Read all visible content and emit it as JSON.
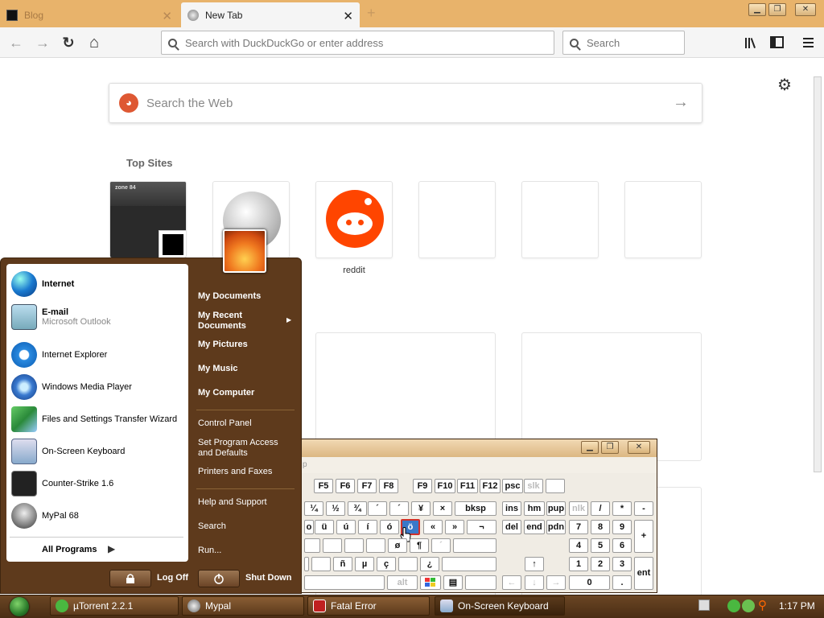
{
  "browser": {
    "tabs": [
      {
        "label": "Blog",
        "active": false
      },
      {
        "label": "New Tab",
        "active": true
      }
    ],
    "new_tab_symbol": "+",
    "window_controls": {
      "minimize": "▁",
      "restore": "❐",
      "close": "✕"
    },
    "nav": {
      "back": "←",
      "forward": "→",
      "reload": "↻",
      "home": "⌂"
    },
    "address_placeholder": "Search with DuckDuckGo or enter address",
    "search_placeholder": "Search",
    "toolbar_icons": [
      "library-icon",
      "sidebar-icon",
      "menu-icon"
    ]
  },
  "newtab": {
    "web_search_placeholder": "Search the Web",
    "top_sites_heading": "Top Sites",
    "tiles": [
      {
        "label": ""
      },
      {
        "label": ""
      },
      {
        "label": "reddit"
      }
    ]
  },
  "start_menu": {
    "left_items": [
      {
        "label": "Internet",
        "sub": "",
        "icon": "globe-icon"
      },
      {
        "label": "E-mail",
        "sub": "Microsoft Outlook",
        "icon": "email-icon"
      },
      {
        "label": "Internet Explorer",
        "sub": "",
        "icon": "ie-icon"
      },
      {
        "label": "Windows Media Player",
        "sub": "",
        "icon": "media-player-icon"
      },
      {
        "label": "Files and Settings Transfer Wizard",
        "sub": "",
        "icon": "transfer-wizard-icon"
      },
      {
        "label": "On-Screen Keyboard",
        "sub": "",
        "icon": "keyboard-icon"
      },
      {
        "label": "Counter-Strike 1.6",
        "sub": "",
        "icon": "counter-strike-icon"
      },
      {
        "label": "MyPal 68",
        "sub": "",
        "icon": "mypal-icon"
      }
    ],
    "all_programs": "All Programs",
    "right_items": {
      "my_documents": "My Documents",
      "my_recent_documents": "My Recent Documents",
      "my_pictures": "My Pictures",
      "my_music": "My Music",
      "my_computer": "My Computer",
      "control_panel": "Control Panel",
      "set_program_access": "Set Program Access and Defaults",
      "printers_faxes": "Printers and Faxes",
      "help_support": "Help and Support",
      "search": "Search",
      "run": "Run..."
    },
    "log_off": "Log Off",
    "shut_down": "Shut Down"
  },
  "osk": {
    "menu_text": "p",
    "fkeys": [
      "F5",
      "F6",
      "F7",
      "F8",
      "F9",
      "F10",
      "F11",
      "F12",
      "psc",
      "slk"
    ],
    "row1": [
      "¼",
      "½",
      "¾",
      "´",
      "´",
      "¥",
      "×",
      "bksp"
    ],
    "row2": [
      "o",
      "ü",
      "ú",
      "í",
      "ó",
      "ö",
      "«",
      "»",
      "¬"
    ],
    "row3": [
      "ø",
      "¶",
      "´"
    ],
    "row4": [
      "ñ",
      "µ",
      "ç",
      "¿"
    ],
    "row5_alt": "alt",
    "nav1": [
      "ins",
      "hm",
      "pup"
    ],
    "nav2": [
      "del",
      "end",
      "pdn"
    ],
    "numpad": {
      "top": [
        "nlk",
        "/",
        "*",
        "-"
      ],
      "r1": [
        "7",
        "8",
        "9"
      ],
      "r2": [
        "4",
        "5",
        "6"
      ],
      "r3": [
        "1",
        "2",
        "3"
      ],
      "zero": "0",
      "dot": ".",
      "plus": "+",
      "enter": "ent"
    },
    "highlighted_key": "ö"
  },
  "taskbar": {
    "buttons": [
      {
        "label": "µTorrent 2.2.1",
        "icon": "utorrent-icon"
      },
      {
        "label": "Mypal",
        "icon": "mypal-icon"
      },
      {
        "label": "Fatal Error",
        "icon": "error-icon"
      },
      {
        "label": "On-Screen Keyboard",
        "icon": "keyboard-icon"
      }
    ],
    "clock": "1:17 PM"
  }
}
